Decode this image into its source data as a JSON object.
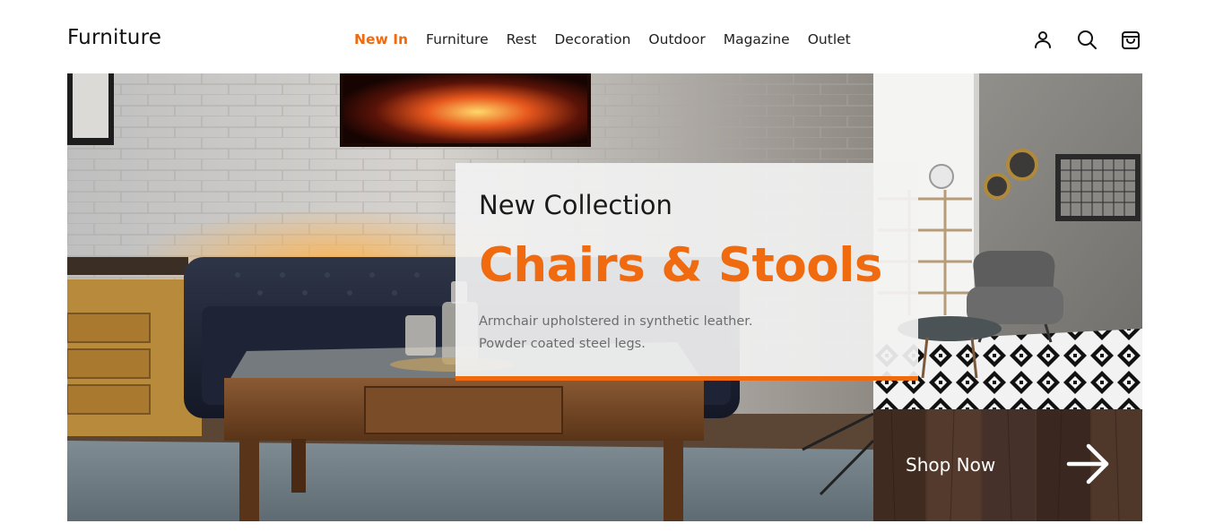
{
  "header": {
    "brand": "Furniture",
    "nav": [
      {
        "label": "New In",
        "active": true
      },
      {
        "label": "Furniture",
        "active": false
      },
      {
        "label": "Rest",
        "active": false
      },
      {
        "label": "Decoration",
        "active": false
      },
      {
        "label": "Outdoor",
        "active": false
      },
      {
        "label": "Magazine",
        "active": false
      },
      {
        "label": "Outlet",
        "active": false
      }
    ],
    "icons": [
      "user-icon",
      "search-icon",
      "shopping-bag-icon"
    ]
  },
  "hero": {
    "subtitle": "New Collection",
    "title": "Chairs & Stools",
    "description_line1": "Armchair upholstered in synthetic leather.",
    "description_line2": "Powder coated steel legs.",
    "cta_label": "Shop Now",
    "cta_icon": "arrow-right-icon"
  },
  "colors": {
    "accent": "#f06a10",
    "text": "#111111",
    "muted": "#6d6d6d"
  }
}
